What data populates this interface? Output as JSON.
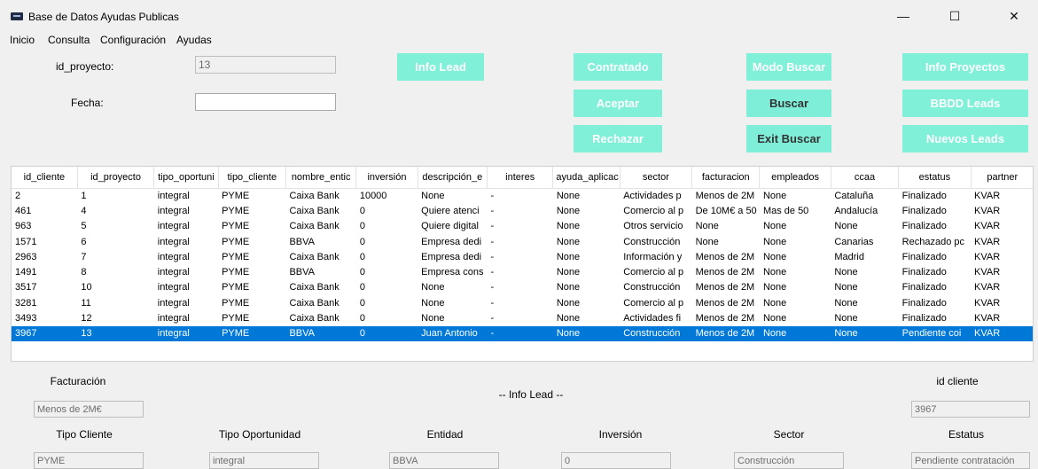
{
  "window": {
    "title": "Base de Datos Ayudas Publicas",
    "minimize": "—",
    "maximize": "☐",
    "close": "✕"
  },
  "menu": [
    "Inicio",
    "Consulta",
    "Configuración",
    "Ayudas"
  ],
  "form": {
    "id_proyecto_label": "id_proyecto:",
    "id_proyecto_value": "13",
    "fecha_label": "Fecha:",
    "fecha_value": ""
  },
  "buttons": {
    "info_lead": "Info Lead",
    "contratado": "Contratado",
    "aceptar": "Aceptar",
    "rechazar": "Rechazar",
    "modo_buscar": "Modo Buscar",
    "buscar": "Buscar",
    "exit_buscar": "Exit Buscar",
    "info_proyectos": "Info Proyectos",
    "bbdd_leads": "BBDD Leads",
    "nuevos_leads": "Nuevos Leads"
  },
  "colors": {
    "button_accent": "#7feed8",
    "selection": "#0078d7"
  },
  "table": {
    "columns": [
      "id_cliente",
      "id_proyecto",
      "tipo_oportuni",
      "tipo_cliente",
      "nombre_entic",
      "inversión",
      "descripción_e",
      "interes",
      "ayuda_aplicac",
      "sector",
      "facturacion",
      "empleados",
      "ccaa",
      "estatus",
      "partner"
    ],
    "rows": [
      [
        "2",
        "1",
        "integral",
        "PYME",
        "Caixa Bank",
        "10000",
        "None",
        "-",
        "None",
        "Actividades p",
        "Menos de 2M",
        "None",
        "Cataluña",
        "Finalizado",
        "KVAR"
      ],
      [
        "461",
        "4",
        "integral",
        "PYME",
        "Caixa Bank",
        "0",
        "Quiere atenci",
        "-",
        "None",
        "Comercio al p",
        "De 10M€ a 50",
        "Mas de 50",
        "Andalucía",
        "Finalizado",
        "KVAR"
      ],
      [
        "963",
        "5",
        "integral",
        "PYME",
        "Caixa Bank",
        "0",
        "Quiere digital",
        "-",
        "None",
        "Otros servicio",
        "None",
        "None",
        "None",
        "Finalizado",
        "KVAR"
      ],
      [
        "1571",
        "6",
        "integral",
        "PYME",
        "BBVA",
        "0",
        "Empresa dedi",
        "-",
        "None",
        "Construcción",
        "None",
        "None",
        "Canarias",
        "Rechazado pc",
        "KVAR"
      ],
      [
        "2963",
        "7",
        "integral",
        "PYME",
        "Caixa Bank",
        "0",
        "Empresa dedi",
        "-",
        "None",
        "Información y",
        "Menos de 2M",
        "None",
        "Madrid",
        "Finalizado",
        "KVAR"
      ],
      [
        "1491",
        "8",
        "integral",
        "PYME",
        "BBVA",
        "0",
        "Empresa cons",
        "-",
        "None",
        "Comercio al p",
        "Menos de 2M",
        "None",
        "None",
        "Finalizado",
        "KVAR"
      ],
      [
        "3517",
        "10",
        "integral",
        "PYME",
        "Caixa Bank",
        "0",
        "None",
        "-",
        "None",
        "Construcción",
        "Menos de 2M",
        "None",
        "None",
        "Finalizado",
        "KVAR"
      ],
      [
        "3281",
        "11",
        "integral",
        "PYME",
        "Caixa Bank",
        "0",
        "None",
        "-",
        "None",
        "Comercio al p",
        "Menos de 2M",
        "None",
        "None",
        "Finalizado",
        "KVAR"
      ],
      [
        "3493",
        "12",
        "integral",
        "PYME",
        "Caixa Bank",
        "0",
        "None",
        "-",
        "None",
        "Actividades fi",
        "Menos de 2M",
        "None",
        "None",
        "Finalizado",
        "KVAR"
      ],
      [
        "3967",
        "13",
        "integral",
        "PYME",
        "BBVA",
        "0",
        "Juan Antonio",
        "-",
        "None",
        "Construcción",
        "Menos de 2M",
        "None",
        "None",
        "Pendiente coi",
        "KVAR"
      ]
    ],
    "selected_row": 9
  },
  "info_lead": {
    "heading": "-- Info Lead --",
    "facturacion_label": "Facturación",
    "facturacion_value": "Menos de 2M€",
    "id_cliente_label": "id cliente",
    "id_cliente_value": "3967",
    "tipo_cliente_label": "Tipo Cliente",
    "tipo_cliente_value": "PYME",
    "tipo_oportunidad_label": "Tipo Oportunidad",
    "tipo_oportunidad_value": "integral",
    "entidad_label": "Entidad",
    "entidad_value": "BBVA",
    "inversion_label": "Inversión",
    "inversion_value": "0",
    "sector_label": "Sector",
    "sector_value": "Construcción",
    "estatus_label": "Estatus",
    "estatus_value": "Pendiente contratación"
  }
}
